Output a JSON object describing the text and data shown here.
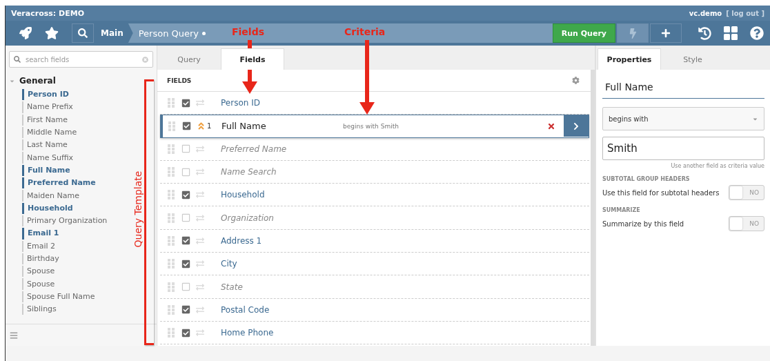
{
  "window": {
    "title": "Veracross: DEMO",
    "user": "vc.demo",
    "logout": "[ log out ]"
  },
  "nav": {
    "crumb": "Main",
    "title": "Person Query",
    "modified": true,
    "run_button": "Run Query"
  },
  "sidebar": {
    "search_placeholder": "search fields",
    "group": {
      "label": "General",
      "expanded": true,
      "items": [
        {
          "label": "Person ID",
          "in_query": true
        },
        {
          "label": "Name Prefix",
          "in_query": false
        },
        {
          "label": "First Name",
          "in_query": false
        },
        {
          "label": "Middle Name",
          "in_query": false
        },
        {
          "label": "Last Name",
          "in_query": false
        },
        {
          "label": "Name Suffix",
          "in_query": false
        },
        {
          "label": "Full Name",
          "in_query": true
        },
        {
          "label": "Preferred Name",
          "in_query": true
        },
        {
          "label": "Maiden Name",
          "in_query": false
        },
        {
          "label": "Household",
          "in_query": true
        },
        {
          "label": "Primary Organization",
          "in_query": false
        },
        {
          "label": "Email 1",
          "in_query": true
        },
        {
          "label": "Email 2",
          "in_query": false
        },
        {
          "label": "Birthday",
          "in_query": false
        },
        {
          "label": "Spouse",
          "in_query": false
        },
        {
          "label": "Spouse",
          "in_query": false
        },
        {
          "label": "Spouse Full Name",
          "in_query": false
        },
        {
          "label": "Siblings",
          "in_query": false
        }
      ]
    }
  },
  "tabs": [
    {
      "label": "Query",
      "selected": false
    },
    {
      "label": "Fields",
      "selected": true
    }
  ],
  "fields": {
    "header": "FIELDS",
    "rows": [
      {
        "name": "Person ID",
        "checked": true,
        "selected": false
      },
      {
        "name": "Full Name",
        "checked": true,
        "selected": true,
        "sort_order": "1",
        "criteria": "begins with Smith"
      },
      {
        "name": "Preferred Name",
        "checked": false,
        "selected": false
      },
      {
        "name": "Name Search",
        "checked": false,
        "selected": false
      },
      {
        "name": "Household",
        "checked": true,
        "selected": false
      },
      {
        "name": "Organization",
        "checked": false,
        "selected": false
      },
      {
        "name": "Address 1",
        "checked": true,
        "selected": false
      },
      {
        "name": "City",
        "checked": true,
        "selected": false
      },
      {
        "name": "State",
        "checked": false,
        "selected": false
      },
      {
        "name": "Postal Code",
        "checked": true,
        "selected": false
      },
      {
        "name": "Home Phone",
        "checked": true,
        "selected": false
      }
    ]
  },
  "properties": {
    "tabs": [
      {
        "label": "Properties",
        "selected": true
      },
      {
        "label": "Style",
        "selected": false
      }
    ],
    "field_name": "Full Name",
    "operator": "begins with",
    "value": "Smith",
    "hint": "Use another field as criteria value",
    "sections": [
      {
        "heading": "SUBTOTAL GROUP HEADERS",
        "label": "Use this field for subtotal headers",
        "toggle": {
          "on": false,
          "text": "NO"
        }
      },
      {
        "heading": "SUMMARIZE",
        "label": "Summarize by this field",
        "toggle": {
          "on": false,
          "text": "NO"
        }
      }
    ]
  },
  "annotations": [
    {
      "kind": "arrow",
      "label": "Fields"
    },
    {
      "kind": "arrow",
      "label": "Criteria"
    },
    {
      "kind": "bracket",
      "label": "Query Template"
    }
  ]
}
